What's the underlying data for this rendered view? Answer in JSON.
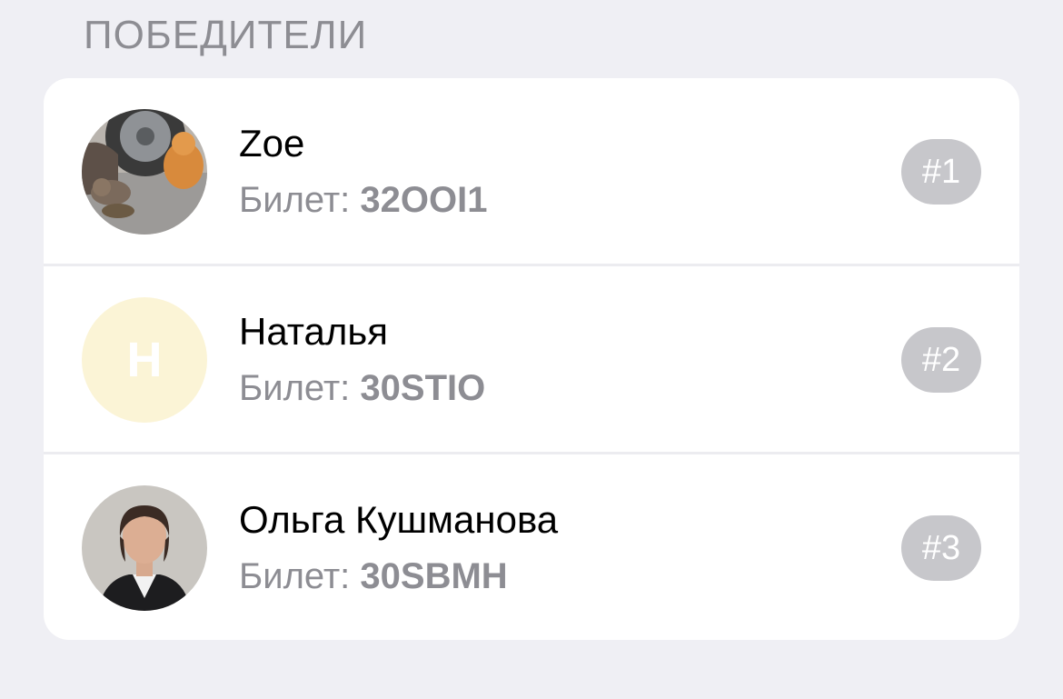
{
  "section": {
    "title": "ПОБЕДИТЕЛИ"
  },
  "winners": [
    {
      "name": "Zoe",
      "ticket_label": "Билет:",
      "ticket_code": "32OOI1",
      "rank": "#1",
      "avatar": "photo-cats"
    },
    {
      "name": "Наталья",
      "ticket_label": "Билет:",
      "ticket_code": "30STIO",
      "rank": "#2",
      "avatar_letter": "Н",
      "avatar_color": "#fbf4d6"
    },
    {
      "name": "Ольга Кушманова",
      "ticket_label": "Билет:",
      "ticket_code": "30SBMH",
      "rank": "#3",
      "avatar": "photo-woman"
    }
  ]
}
